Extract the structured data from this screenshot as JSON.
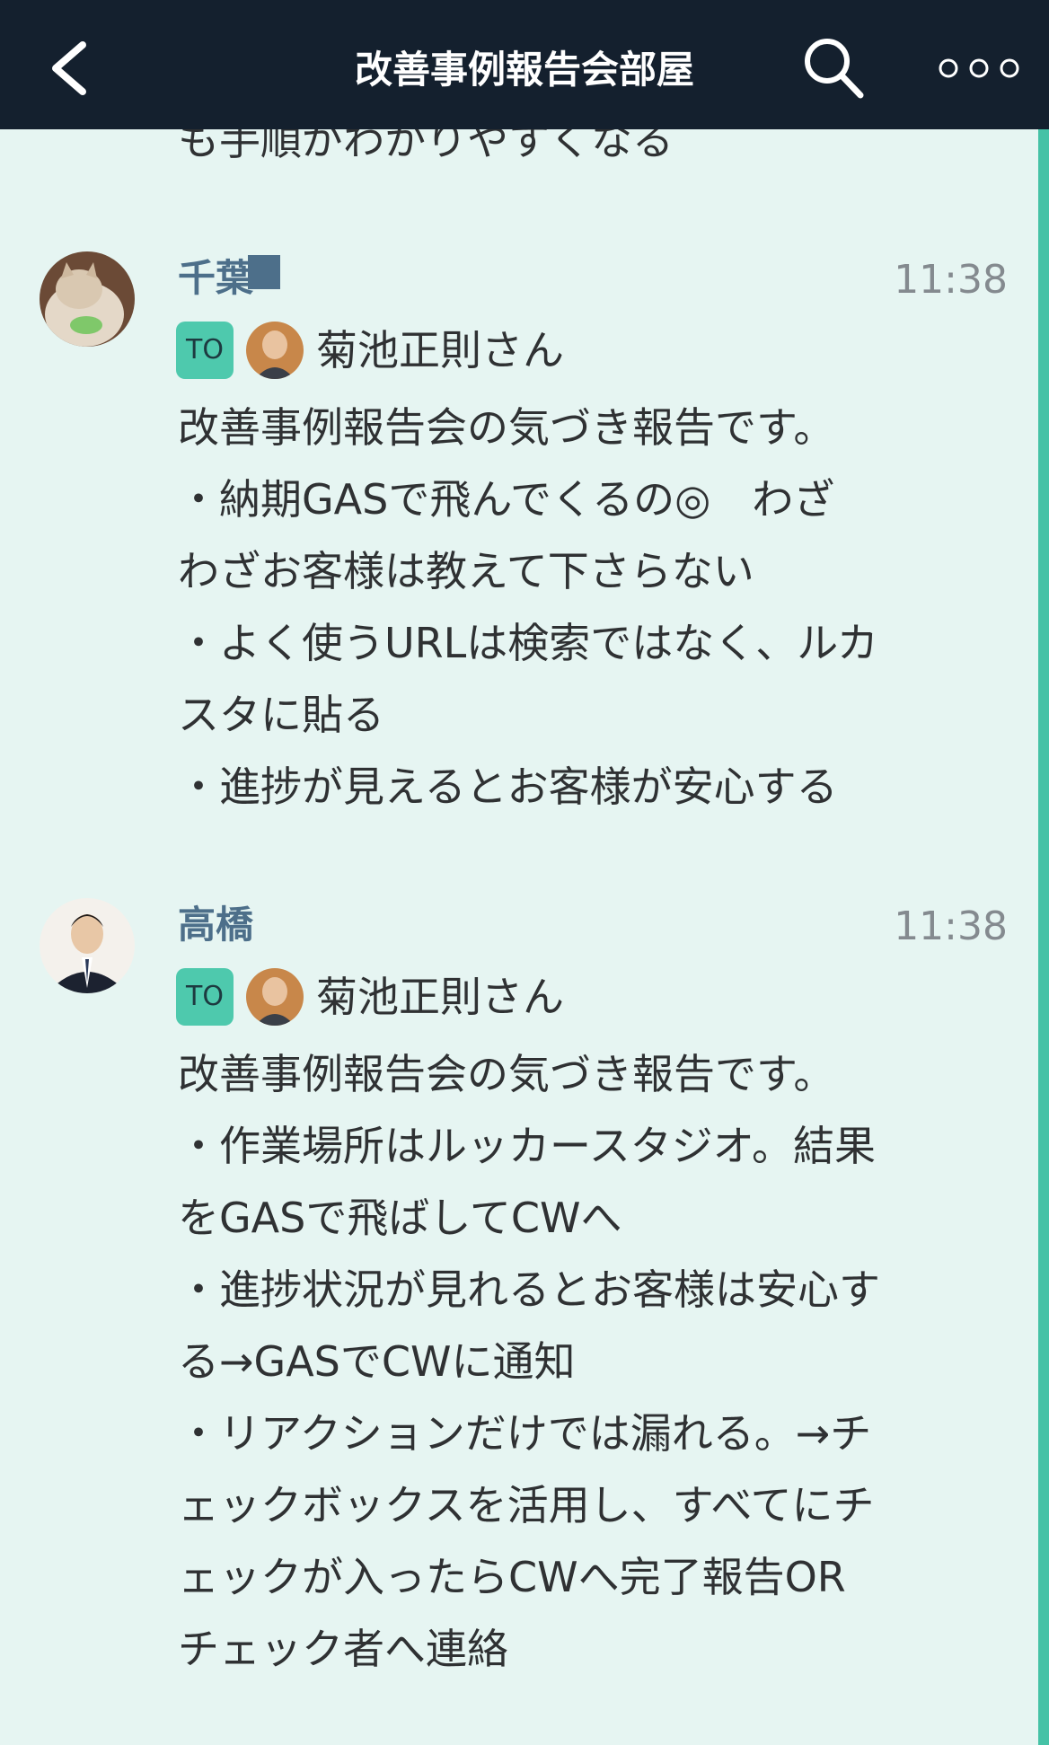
{
  "header": {
    "title": "改善事例報告会部屋"
  },
  "previous_message_tail": "も手順がわかりやすくなる",
  "messages": [
    {
      "sender": "千葉",
      "time": "11:38",
      "to_label": "TO",
      "to_name": "菊池正則さん",
      "lines": [
        "改善事例報告会の気づき報告です。",
        "・納期GASで飛んでくるの◎　わざ",
        "わざお客様は教えて下さらない",
        "・よく使うURLは検索ではなく、ルカ",
        "スタに貼る",
        "・進捗が見えるとお客様が安心する"
      ]
    },
    {
      "sender": "高橋",
      "time": "11:38",
      "to_label": "TO",
      "to_name": "菊池正則さん",
      "lines": [
        "改善事例報告会の気づき報告です。",
        "・作業場所はルッカースタジオ。結果",
        "をGASで飛ばしてCWへ",
        "・進捗状況が見れるとお客様は安心す",
        "る→GASでCWに通知",
        "・リアクションだけでは漏れる。→チ",
        "ェックボックスを活用し、すべてにチ",
        "ェックが入ったらCWへ完了報告OR",
        "チェック者へ連絡"
      ]
    }
  ],
  "colors": {
    "header_bg": "#14202e",
    "chat_bg": "#e6f5f2",
    "accent": "#4ec9ad",
    "sender_name": "#4d6f8a",
    "time": "#848a8f"
  }
}
